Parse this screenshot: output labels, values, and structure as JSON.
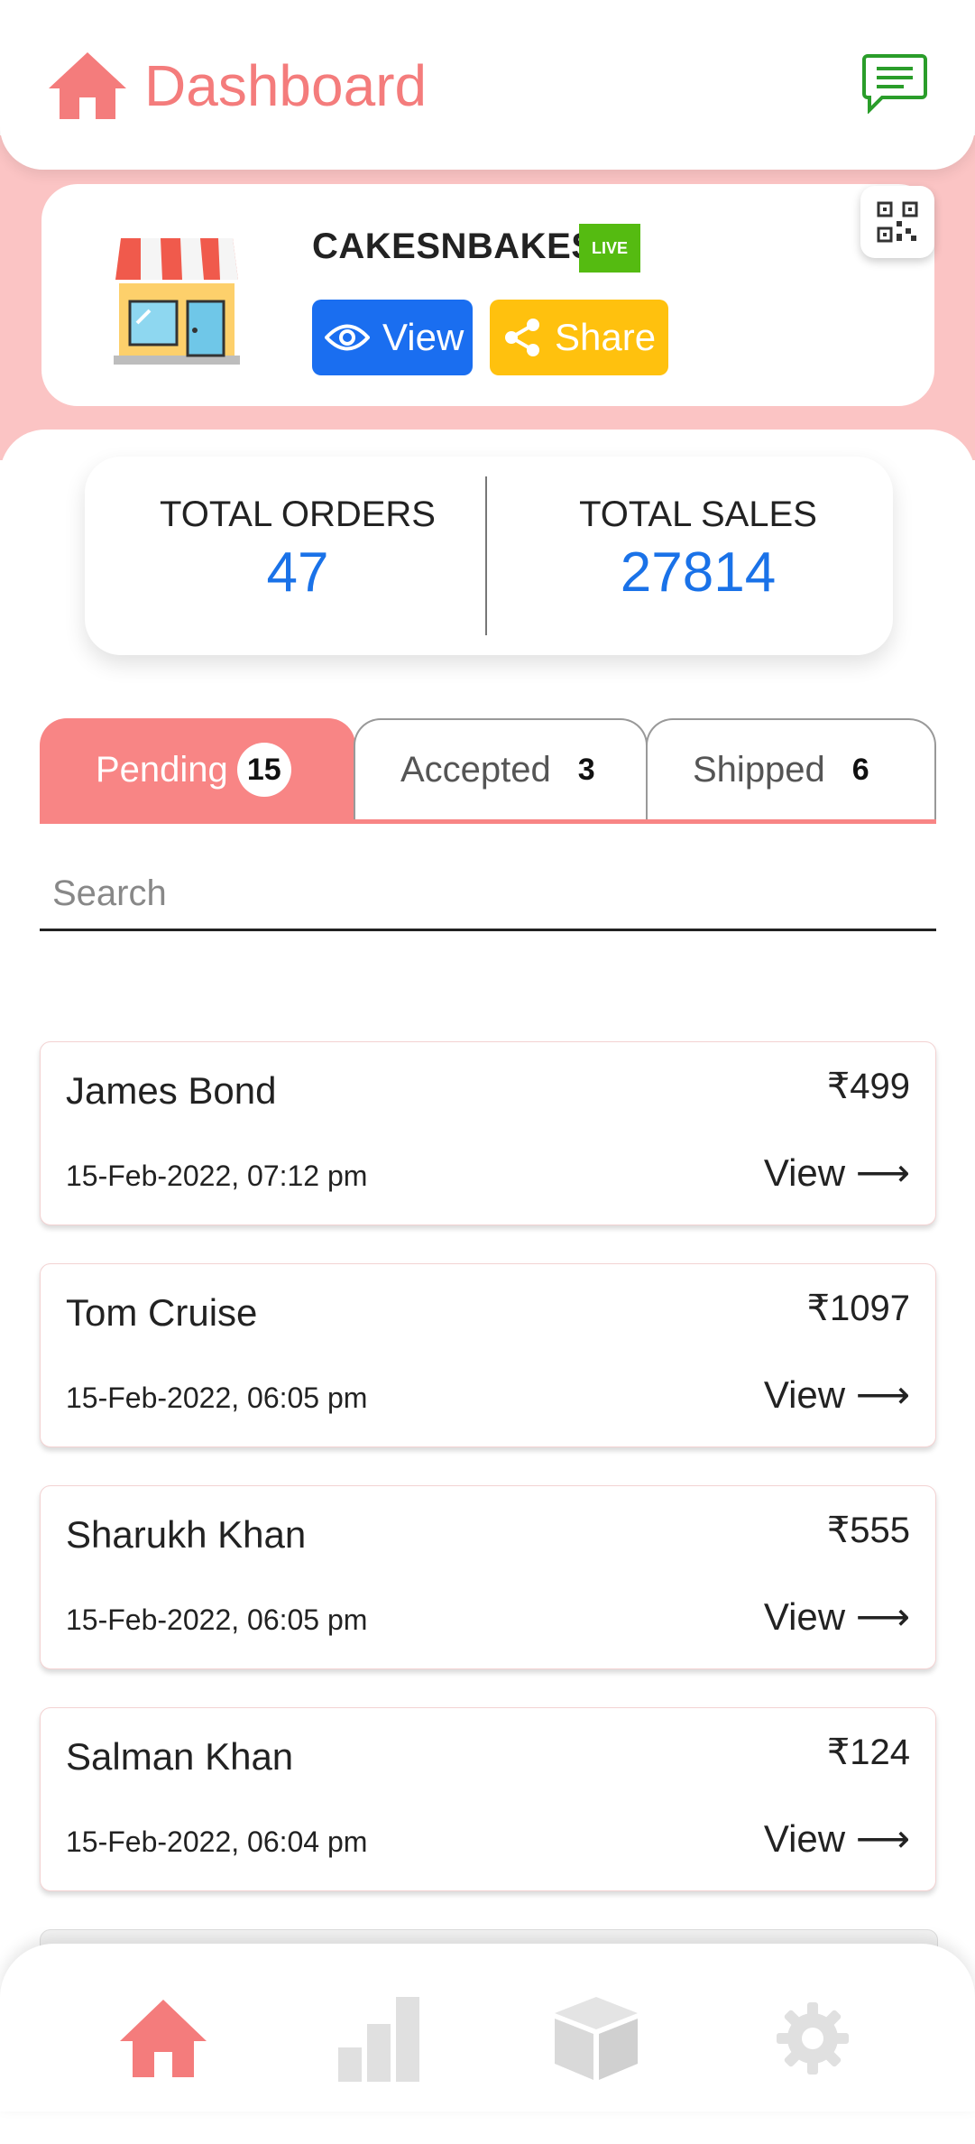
{
  "header": {
    "title": "Dashboard",
    "home_icon": "home-icon",
    "chat_icon": "chat-icon",
    "accent": "#f47c7c"
  },
  "store": {
    "name": "CAKESNBAKES",
    "status_badge": "LIVE",
    "view_label": "View",
    "share_label": "Share",
    "qr_icon": "qr-code-icon"
  },
  "stats": {
    "total_orders_label": "TOTAL ORDERS",
    "total_orders_value": "47",
    "total_sales_label": "TOTAL SALES",
    "total_sales_value": "27814"
  },
  "tabs": [
    {
      "label": "Pending",
      "count": "15",
      "active": true
    },
    {
      "label": "Accepted",
      "count": "3",
      "active": false
    },
    {
      "label": "Shipped",
      "count": "6",
      "active": false
    }
  ],
  "search": {
    "placeholder": "Search",
    "value": ""
  },
  "orders": [
    {
      "name": "James Bond",
      "date": "15-Feb-2022, 07:12 pm",
      "amount": "₹499",
      "action": "View ⟶"
    },
    {
      "name": "Tom Cruise",
      "date": "15-Feb-2022, 06:05 pm",
      "amount": "₹1097",
      "action": "View ⟶"
    },
    {
      "name": "Sharukh Khan",
      "date": "15-Feb-2022, 06:05 pm",
      "amount": "₹555",
      "action": "View ⟶"
    },
    {
      "name": "Salman Khan",
      "date": "15-Feb-2022, 06:04 pm",
      "amount": "₹124",
      "action": "View ⟶"
    }
  ],
  "bottom_nav": [
    {
      "icon": "home-icon",
      "active": true
    },
    {
      "icon": "bar-chart-icon",
      "active": false
    },
    {
      "icon": "box-icon",
      "active": false
    },
    {
      "icon": "gear-icon",
      "active": false
    }
  ],
  "colors": {
    "view_button": "#1a6ef0",
    "share_button": "#ffc10e",
    "live_badge": "#55bb11",
    "stat_value": "#1a72e8",
    "pending_tab": "#f88585"
  }
}
